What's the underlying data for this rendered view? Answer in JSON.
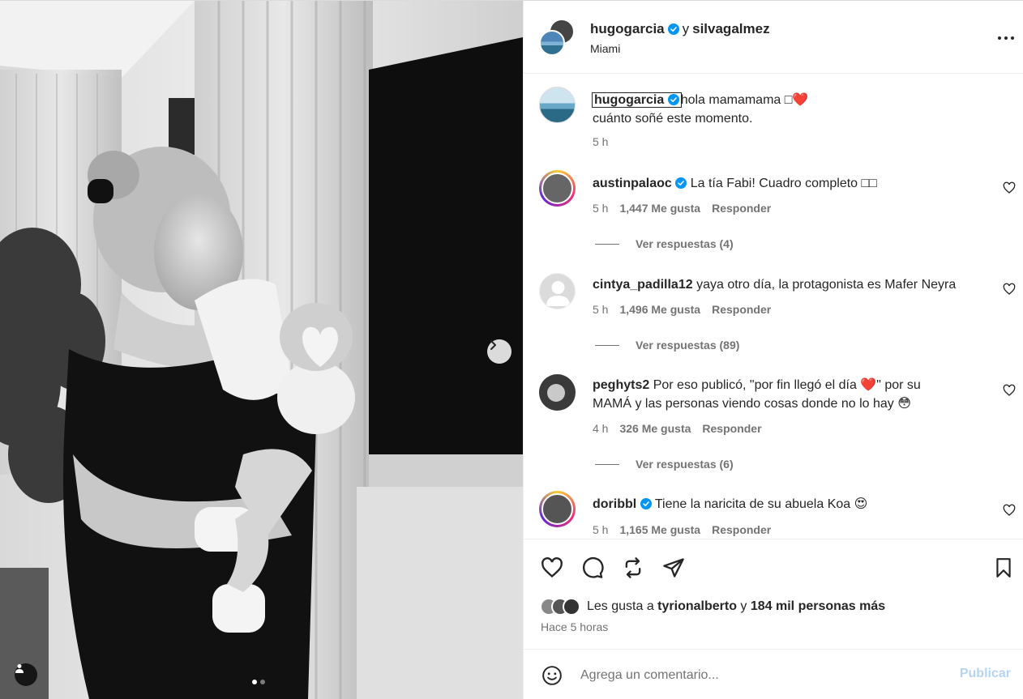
{
  "post": {
    "author": "hugogarcia",
    "conjunction": "y",
    "coauthor": "silvagalmez",
    "location": "Miami"
  },
  "caption": {
    "username": "hugogarcia",
    "text": "hola mamamama □",
    "emoji": "❤️",
    "line2": "cuánto soñé este momento.",
    "time": "5 h"
  },
  "comments": [
    {
      "username": "austinpalaoc",
      "verified": true,
      "text": "La tía Fabi! Cuadro completo □□",
      "time": "5 h",
      "likes": "1,447 Me gusta",
      "reply_label": "Responder",
      "view_replies": "Ver respuestas (4)"
    },
    {
      "username": "cintya_padilla12",
      "verified": false,
      "text": "yaya otro día, la protagonista es Mafer Neyra",
      "time": "5 h",
      "likes": "1,496 Me gusta",
      "reply_label": "Responder",
      "view_replies": "Ver respuestas (89)"
    },
    {
      "username": "peghyts2",
      "verified": false,
      "text": "Por eso publicó, \"por fin llegó el día ",
      "text_emoji": "❤️",
      "text_cont": "\" por su",
      "text_line2": "MAMÁ y las personas viendo cosas donde no lo hay ",
      "text_line2_emoji": "😳",
      "time": "4 h",
      "likes": "326 Me gusta",
      "reply_label": "Responder",
      "view_replies": "Ver respuestas (6)"
    },
    {
      "username": "doribbl",
      "verified": true,
      "text": "Tiene la naricita de su abuela Koa ",
      "text_emoji": "😍",
      "time": "5 h",
      "likes": "1,165 Me gusta",
      "reply_label": "Responder"
    }
  ],
  "footer": {
    "likes_prefix": "Les gusta a ",
    "likes_user": "tyrionalberto",
    "likes_middle": " y ",
    "likes_count": "184 mil personas más",
    "time_ago": "Hace 5 horas"
  },
  "composer": {
    "placeholder": "Agrega un comentario...",
    "publish_label": "Publicar"
  },
  "carousel": {
    "current": 1,
    "total": 2
  },
  "colors": {
    "verified": "#0095f6",
    "text": "#262626",
    "muted": "#737373",
    "publish_disabled": "#b3d4f5",
    "heart": "#e0212f"
  },
  "icons": [
    "more-icon",
    "verified-icon",
    "chevron-right-icon",
    "user-tag-icon",
    "heart-icon",
    "comment-icon",
    "repost-icon",
    "share-icon",
    "bookmark-icon",
    "emoji-icon"
  ]
}
